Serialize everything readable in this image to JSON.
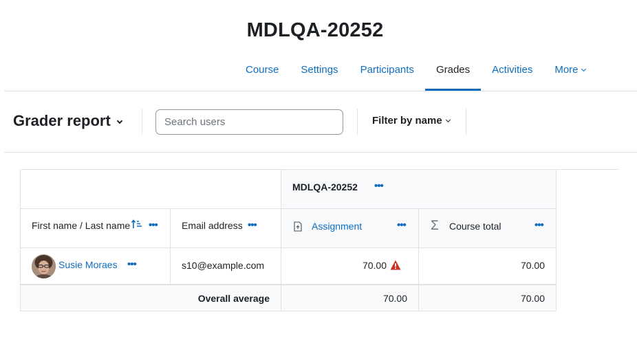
{
  "course": {
    "title": "MDLQA-20252"
  },
  "nav": {
    "tabs": [
      {
        "label": "Course",
        "active": false
      },
      {
        "label": "Settings",
        "active": false
      },
      {
        "label": "Participants",
        "active": false
      },
      {
        "label": "Grades",
        "active": true
      },
      {
        "label": "Activities",
        "active": false
      },
      {
        "label": "More",
        "active": false,
        "dropdown": true
      }
    ]
  },
  "toolbar": {
    "report_label": "Grader report",
    "search_placeholder": "Search users",
    "filter_label": "Filter by name"
  },
  "grader": {
    "category_header": "MDLQA-20252",
    "columns": {
      "name": "First name / Last name",
      "email": "Email address",
      "assignment": "Assignment",
      "course_total": "Course total"
    },
    "rows": [
      {
        "name": "Susie Moraes",
        "email": "s10@example.com",
        "assignment_grade": "70.00",
        "course_total": "70.00"
      }
    ],
    "average": {
      "label": "Overall average",
      "assignment": "70.00",
      "course_total": "70.00"
    },
    "menu_glyph": "•••"
  },
  "colors": {
    "link": "#0f6cbf",
    "warning": "#ca3120",
    "border": "#dee2e6",
    "header_bg": "#f8f9fa"
  },
  "icons": [
    "chevron-down-icon",
    "sort-ascending-icon",
    "assignment-icon",
    "sigma-icon",
    "warning-icon",
    "avatar"
  ]
}
